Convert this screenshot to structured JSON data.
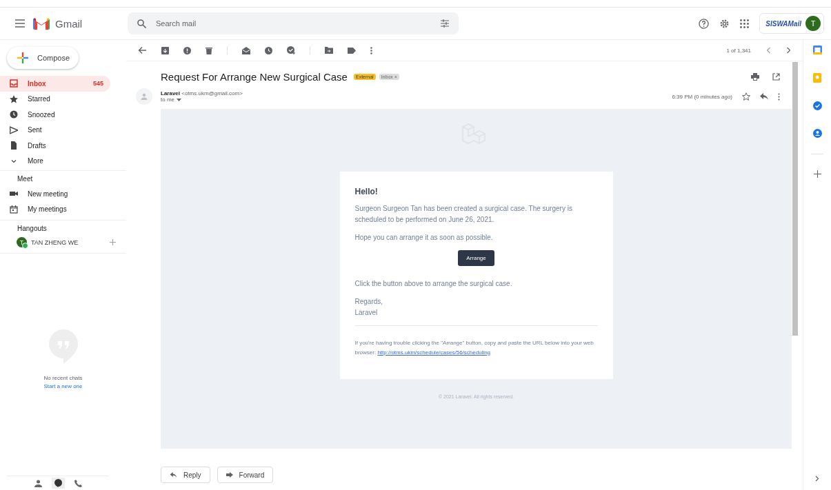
{
  "header": {
    "app_name": "Gmail",
    "search": {
      "placeholder": "Search mail"
    },
    "account": {
      "logo_text": "SISWAMail",
      "avatar": "T"
    }
  },
  "sidebar": {
    "compose": "Compose",
    "items": [
      {
        "label": "Inbox",
        "count": "545",
        "selected": true
      },
      {
        "label": "Starred",
        "selected": false
      },
      {
        "label": "Snoozed",
        "selected": false
      },
      {
        "label": "Sent",
        "selected": false
      },
      {
        "label": "Drafts",
        "selected": false
      },
      {
        "label": "More",
        "selected": false
      }
    ],
    "meet": {
      "title": "Meet",
      "items": [
        "New meeting",
        "My meetings"
      ]
    },
    "hangouts": {
      "title": "Hangouts",
      "contact": {
        "avatar": "T",
        "name": "TAN ZHENG WE",
        "online": true
      },
      "empty_text": "No recent chats",
      "start_link": "Start a new one"
    }
  },
  "toolbar": {
    "pager": "1 of 1,341"
  },
  "message": {
    "subject": "Request For Arrange New Surgical Case",
    "labels": [
      {
        "text": "External",
        "kind": "external"
      },
      {
        "text": "Inbox",
        "kind": "folder",
        "close": "×"
      }
    ],
    "sender_name": "Laravel",
    "sender_email": "<otms.ukm@gmail.com>",
    "recipient": "to me",
    "time": "6:39 PM (0 minutes ago)",
    "body": {
      "greeting": "Hello!",
      "paragraphs": [
        "Surgeon Surgeon Tan has been created a surgical case. The surgery is scheduled to be performed on June 26, 2021.",
        "Hope you can arrange it as soon as possible."
      ],
      "button": "Arrange",
      "closing": "Click the button above to arrange the surgical case.",
      "signature": [
        "Regards,",
        "Laravel"
      ],
      "trouble_text": "If you're having trouble clicking the \"Arrange\" button, copy and paste the URL below into your web browser:",
      "url": "http://otms.ukm/schedule/cases/56/scheduling",
      "copyright": "© 2021 Laravel. All rights reserved."
    }
  },
  "actions": [
    "Reply",
    "Forward"
  ]
}
